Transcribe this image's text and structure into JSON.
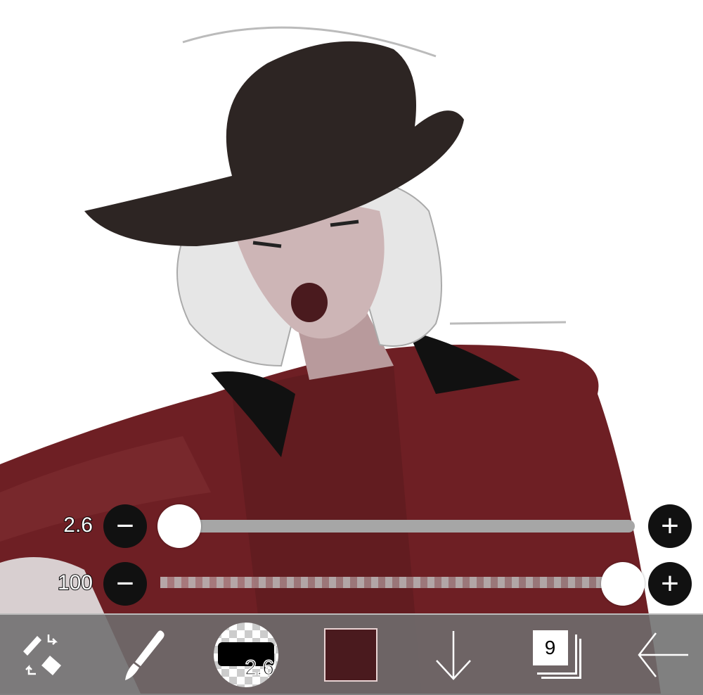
{
  "sliders": {
    "brush_size": {
      "value_label": "2.6",
      "fraction": 0.0
    },
    "opacity": {
      "value_label": "100",
      "fraction": 1.0
    }
  },
  "toolbar": {
    "brush_size_label": "2.6",
    "current_color": "#4a1a1e",
    "layer_count": "9"
  },
  "icons": [
    "transform-eraser-swap-icon",
    "brush-icon",
    "brush-size-preview-icon",
    "color-swatch",
    "arrow-down-icon",
    "layers-icon",
    "back-arrow-icon",
    "minus-icon",
    "plus-icon"
  ]
}
